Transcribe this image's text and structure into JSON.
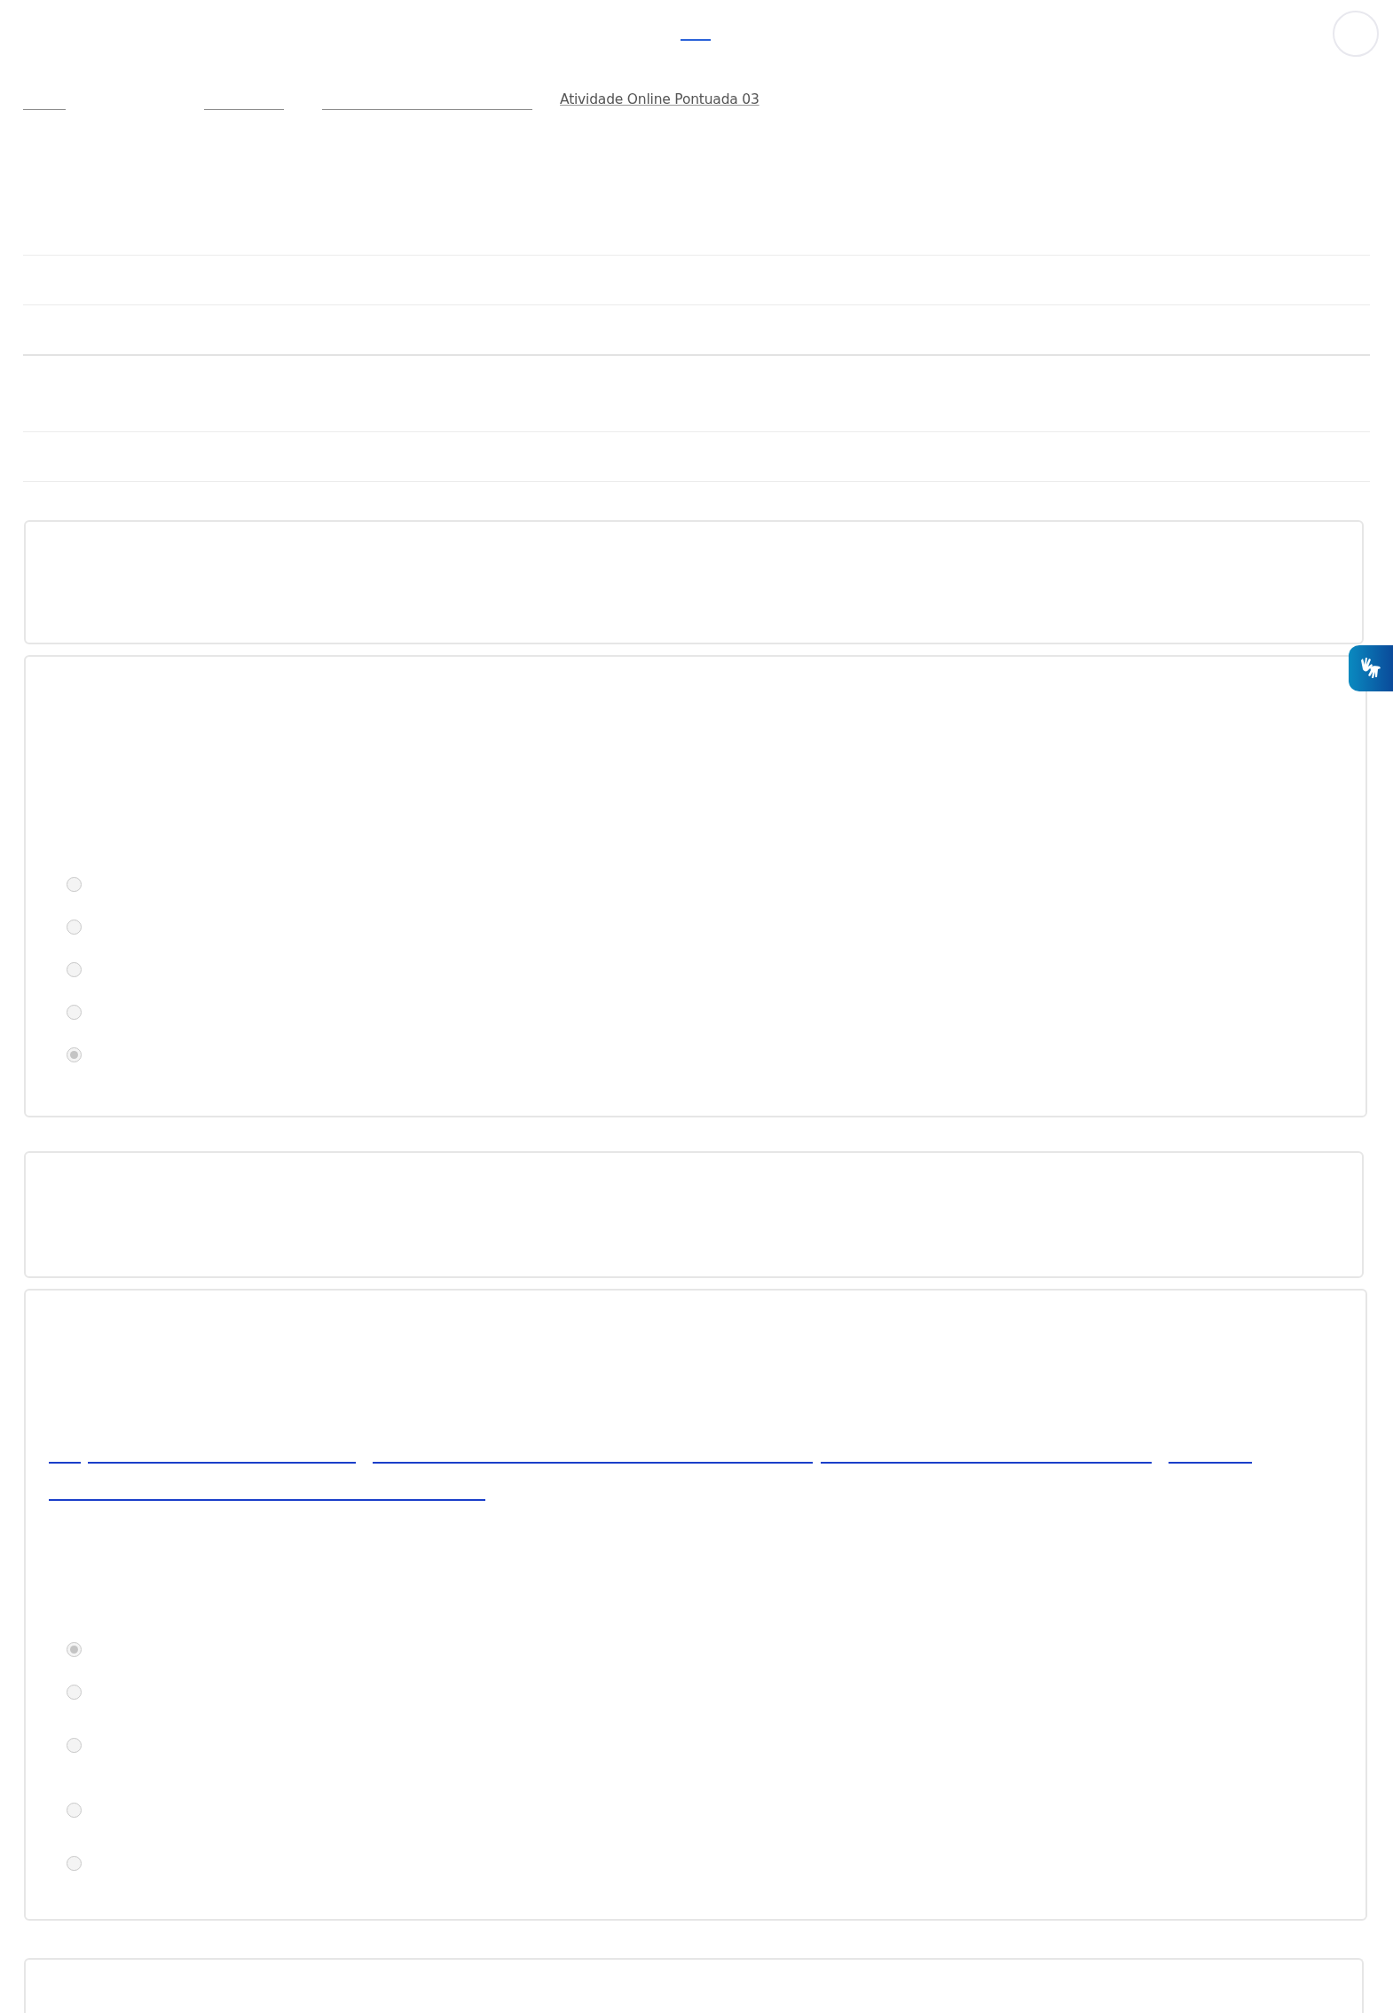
{
  "breadcrumb": {
    "current": "Atividade Online Pontuada 03"
  },
  "questions": [
    {
      "options": [
        {
          "selected": false
        },
        {
          "selected": false
        },
        {
          "selected": false
        },
        {
          "selected": false
        },
        {
          "selected": true
        }
      ]
    },
    {
      "options": [
        {
          "selected": true
        },
        {
          "selected": false
        },
        {
          "selected": false
        },
        {
          "selected": false
        },
        {
          "selected": false
        }
      ]
    }
  ]
}
